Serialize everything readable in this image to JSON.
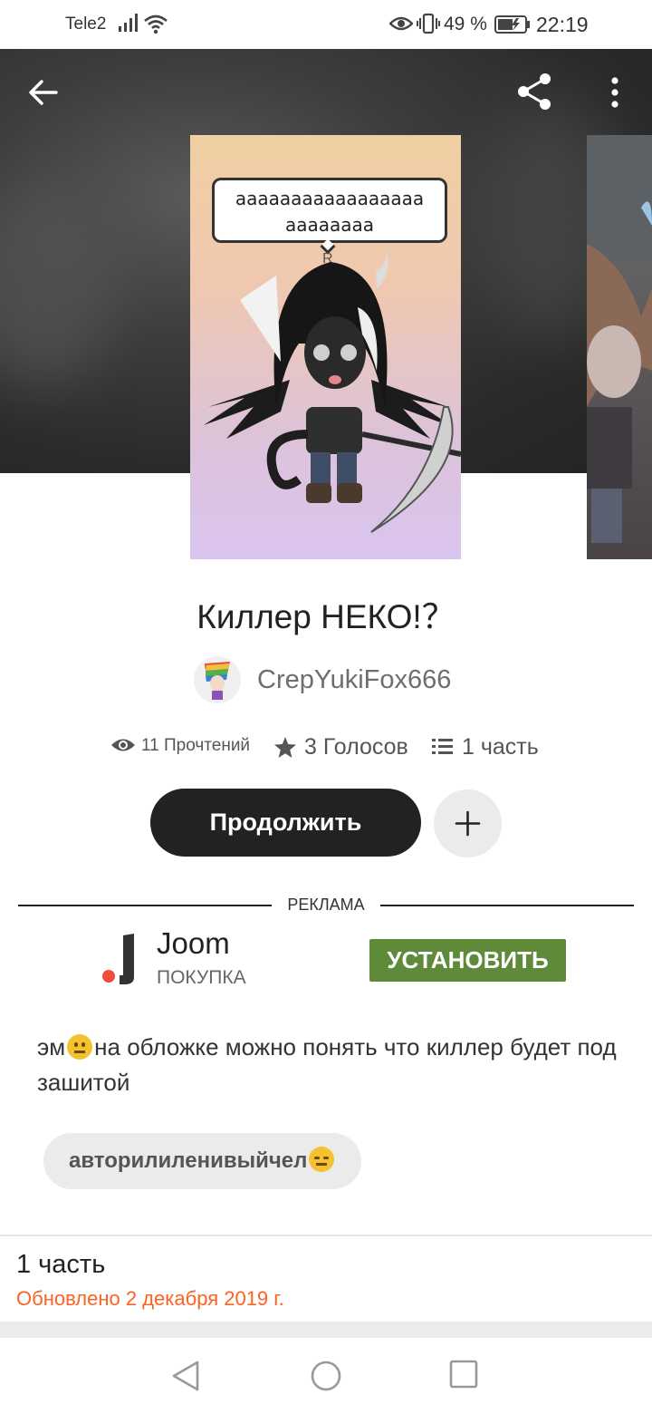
{
  "status_bar": {
    "carrier": "Tele2",
    "battery": "49 %",
    "time": "22:19",
    "icons": [
      "signal-icon",
      "wifi-icon",
      "eye-comfort-icon",
      "vibrate-icon",
      "battery-icon"
    ]
  },
  "header": {
    "back_icon": "arrow-left-icon",
    "share_icon": "share-icon",
    "more_icon": "more-vertical-icon"
  },
  "cover": {
    "bubble_text_line1": "ааааааааааааааааа",
    "bubble_text_line2": "аааааааа",
    "sub_text": "Я"
  },
  "story": {
    "title": "Киллер НЕКО!？",
    "author": "CrepYukiFox666",
    "reads": "11 Прочтений",
    "votes": "3 Голосов",
    "parts": "1 часть",
    "continue_label": "Продолжить",
    "add_icon": "plus-icon"
  },
  "ad": {
    "label": "РЕКЛАМА",
    "app_name": "Joom",
    "category": "ПОКУПКА",
    "install_label": "УСТАНОВИТЬ"
  },
  "description": {
    "prefix": "эм",
    "text": "на обложке можно понять что киллер будет под зашитой"
  },
  "tags": [
    "авторилиленивыйчел"
  ],
  "parts_section": {
    "title": "1 часть",
    "updated": "Обновлено 2 декабря 2019 г."
  },
  "nav_bar": {
    "icons": [
      "nav-back-icon",
      "nav-home-icon",
      "nav-recent-icon"
    ]
  },
  "colors": {
    "accent": "#ff6122",
    "button_dark": "#222222",
    "install_green": "#5e8a3a"
  }
}
